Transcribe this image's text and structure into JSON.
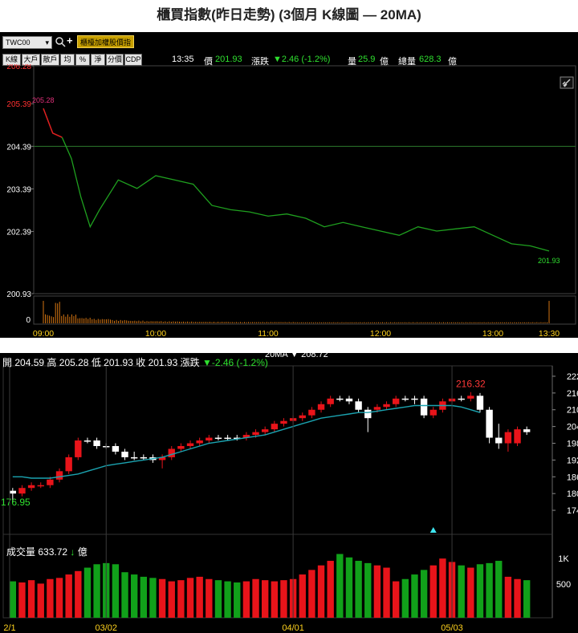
{
  "page": {
    "title": "櫃買指數(昨日走勢) (3個月 K線圖 — 20MA)"
  },
  "intraday": {
    "symbol": "TWC00",
    "search_icon": "magnifier-icon",
    "add_icon": "plus-icon",
    "index_name": "櫃檯加權股價指",
    "tabs": [
      "K線",
      "大戶",
      "散戶",
      "均",
      "%",
      "淨",
      "分價",
      "CDP"
    ],
    "time": "13:35",
    "price_label": "價",
    "price": "201.93",
    "change_label": "漲跌",
    "change": "▼2.46 (-1.2%)",
    "volume_label": "量",
    "volume": "25.9",
    "volume_unit": "億",
    "total_label": "總量",
    "total": "628.3",
    "total_unit": "億",
    "link_icon": "link-icon",
    "y_ticks": [
      "206.28",
      "205.39",
      "204.39",
      "203.39",
      "202.39",
      "200.93"
    ],
    "x_ticks": [
      "09:00",
      "10:00",
      "11:00",
      "12:00",
      "13:00",
      "13:30"
    ],
    "vol_zero_label": "0",
    "open_annotation": "205.28",
    "last_annotation": "201.93",
    "colors": {
      "line": "#1fa01f",
      "up_line": "#e02020",
      "ref_line": "#2c7a2c",
      "volume": "#d47512",
      "text_red": "#ff3030"
    }
  },
  "kline": {
    "ohlc_header": {
      "open_label": "開",
      "open": "204.59",
      "high_label": "高",
      "high": "205.28",
      "low_label": "低",
      "low": "201.93",
      "close_label": "收",
      "close": "201.93",
      "change_label": "漲跌",
      "change": "▼-2.46 (-1.2%)"
    },
    "ma_label": "20MA",
    "ma_value": "▼ 208.72",
    "y_ticks": [
      "222",
      "216",
      "210",
      "204",
      "198",
      "192",
      "186",
      "180",
      "174"
    ],
    "vol_ticks": [
      "1K",
      "500"
    ],
    "volume_label": "成交量",
    "volume_value": "633.72",
    "volume_arrow": "↓",
    "volume_unit": "億",
    "x_ticks": [
      "2/1",
      "03/02",
      "04/01",
      "05/03"
    ],
    "high_annotation": "216.32",
    "low_annotation": "176.95",
    "marker_icon": "triangle-up-icon",
    "colors": {
      "up": "#e8141a",
      "down": "#ffffff",
      "ma": "#1ba3b0",
      "vol_up": "#e8141a",
      "vol_down": "#11a11a"
    }
  },
  "chart_data": [
    {
      "type": "line",
      "title": "",
      "xlabel": "",
      "ylabel": "",
      "x": [
        "09:00",
        "09:05",
        "09:10",
        "09:15",
        "09:20",
        "09:25",
        "09:30",
        "09:40",
        "09:50",
        "10:00",
        "10:10",
        "10:20",
        "10:30",
        "10:40",
        "10:50",
        "11:00",
        "11:10",
        "11:20",
        "11:30",
        "11:40",
        "11:50",
        "12:00",
        "12:10",
        "12:20",
        "12:30",
        "12:40",
        "12:50",
        "13:00",
        "13:10",
        "13:20",
        "13:30"
      ],
      "values": [
        205.28,
        204.7,
        204.6,
        204.1,
        203.2,
        202.5,
        202.9,
        203.6,
        203.4,
        203.7,
        203.6,
        203.5,
        203.0,
        202.9,
        202.85,
        202.75,
        202.8,
        202.7,
        202.5,
        202.6,
        202.5,
        202.4,
        202.3,
        202.5,
        202.4,
        202.45,
        202.5,
        202.3,
        202.1,
        202.05,
        201.93
      ],
      "reference": 204.39,
      "ylim": [
        200.93,
        206.28
      ],
      "volume": [
        1.0,
        0.4,
        0.25,
        0.2,
        0.15,
        0.12,
        0.1,
        0.09,
        0.08,
        0.07,
        0.07,
        0.06,
        0.06,
        0.06,
        0.06,
        0.05,
        0.05,
        0.05,
        0.05,
        0.05,
        0.05,
        0.05,
        0.05,
        0.05,
        0.05,
        0.05,
        0.05,
        0.05,
        0.05,
        0.05,
        1.0
      ]
    },
    {
      "type": "candlestick",
      "title": "",
      "x": [
        "2/1",
        "",
        "",
        "",
        "",
        "",
        "",
        "",
        "",
        "",
        "03/02",
        "",
        "",
        "",
        "",
        "",
        "",
        "",
        "",
        "",
        "",
        "",
        "",
        "",
        "",
        "",
        "",
        "",
        "",
        "",
        "04/01",
        "",
        "",
        "",
        "",
        "",
        "",
        "",
        "",
        "",
        "",
        "",
        "",
        "",
        "",
        "",
        "",
        "05/03",
        "",
        "",
        "",
        ""
      ],
      "open": [
        181,
        180,
        182,
        183,
        183,
        185,
        188,
        193,
        199,
        199,
        197,
        197,
        195,
        193,
        193,
        193,
        192,
        193,
        196,
        197,
        198,
        199,
        200,
        200,
        200,
        200,
        201,
        202,
        203,
        205,
        206,
        207,
        208,
        210,
        212,
        214,
        214,
        213,
        210,
        210,
        211,
        212,
        214,
        214,
        214,
        208,
        210,
        213,
        214,
        214,
        215,
        210,
        200,
        202,
        198,
        203
      ],
      "close": [
        180,
        182,
        183,
        183,
        185,
        188,
        193,
        199,
        199,
        197,
        197,
        195,
        193,
        193,
        193,
        192,
        193,
        196,
        197,
        198,
        199,
        200,
        200,
        200,
        200,
        201,
        202,
        203,
        205,
        206,
        207,
        208,
        210,
        212,
        214,
        214,
        213,
        210,
        207,
        211,
        212,
        214,
        214,
        214,
        208,
        210,
        213,
        214,
        214,
        215,
        210,
        200,
        198,
        198,
        203,
        202
      ],
      "high": [
        182,
        183,
        184,
        184,
        186,
        189,
        194,
        200,
        200,
        200,
        198,
        198,
        196,
        195,
        194,
        194,
        194,
        197,
        198,
        199,
        200,
        201,
        201,
        201,
        201,
        202,
        203,
        204,
        206,
        207,
        208,
        209,
        211,
        213,
        215,
        215,
        215,
        214,
        211,
        212,
        213,
        215,
        215,
        215,
        215,
        211,
        214,
        215,
        215,
        216.32,
        216,
        211,
        205,
        203,
        204,
        204
      ],
      "low": [
        177,
        179,
        181,
        182,
        182,
        184,
        187,
        192,
        198,
        196,
        196,
        194,
        192,
        192,
        192,
        191,
        189,
        192,
        195,
        196,
        197,
        198,
        199,
        199,
        199,
        199,
        200,
        201,
        202,
        204,
        205,
        206,
        207,
        209,
        211,
        213,
        212,
        209,
        202,
        209,
        210,
        211,
        213,
        212,
        207,
        207,
        209,
        212,
        213,
        213,
        209,
        198,
        196,
        195,
        197,
        201
      ],
      "ma20": [
        186,
        186,
        185.5,
        185.5,
        185.5,
        186,
        186.5,
        187,
        188,
        189,
        190,
        190.5,
        191,
        191.5,
        192,
        192.5,
        193,
        194,
        195,
        196,
        197,
        198,
        198.5,
        199,
        199.5,
        200,
        200.5,
        201,
        202,
        203,
        204,
        205,
        206,
        207,
        207.5,
        208,
        208.5,
        209,
        209,
        209.5,
        210,
        210.5,
        211,
        211.5,
        211.5,
        211.5,
        211.5,
        211.5,
        211,
        210,
        209
      ],
      "volume": [
        320,
        310,
        330,
        300,
        340,
        350,
        380,
        410,
        440,
        470,
        480,
        470,
        400,
        380,
        360,
        350,
        340,
        320,
        330,
        350,
        360,
        340,
        330,
        320,
        310,
        320,
        340,
        330,
        320,
        330,
        340,
        380,
        420,
        460,
        500,
        560,
        530,
        500,
        480,
        460,
        440,
        320,
        340,
        380,
        420,
        460,
        520,
        490,
        460,
        440,
        470,
        480,
        500,
        360,
        340,
        330
      ],
      "up": [
        false,
        true,
        true,
        true,
        true,
        true,
        true,
        true,
        false,
        false,
        false,
        false,
        false,
        false,
        false,
        false,
        true,
        true,
        true,
        true,
        true,
        true,
        false,
        false,
        false,
        true,
        true,
        true,
        true,
        true,
        true,
        true,
        true,
        true,
        true,
        false,
        false,
        false,
        false,
        true,
        true,
        true,
        false,
        false,
        false,
        true,
        true,
        true,
        false,
        true,
        false,
        false,
        false,
        true,
        true,
        false
      ],
      "ylim": [
        170,
        224
      ]
    }
  ]
}
